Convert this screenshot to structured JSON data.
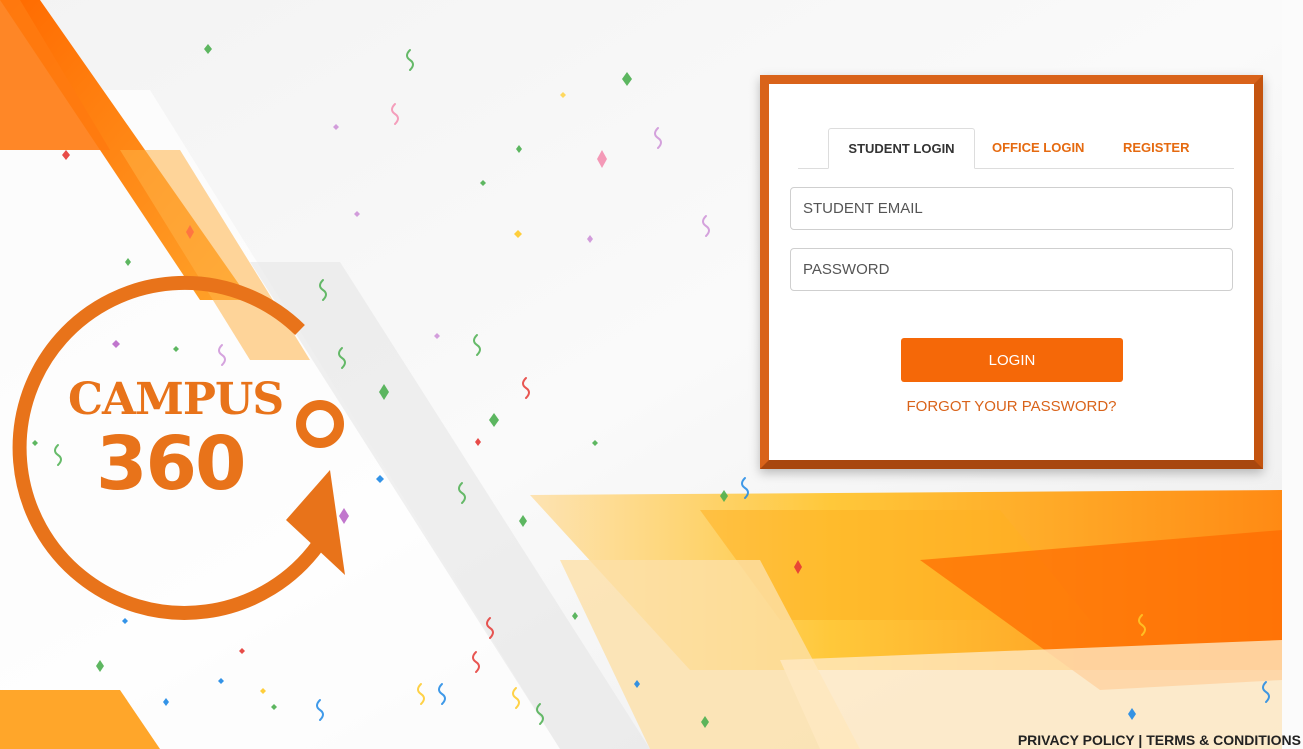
{
  "brand": {
    "word": "CAMPUS",
    "number": "360"
  },
  "tabs": [
    {
      "label": "STUDENT LOGIN",
      "active": true
    },
    {
      "label": "OFFICE LOGIN",
      "active": false
    },
    {
      "label": "REGISTER",
      "active": false
    }
  ],
  "form": {
    "email_placeholder": "STUDENT EMAIL",
    "password_placeholder": "PASSWORD",
    "login_label": "LOGIN",
    "forgot_label": "FORGOT YOUR PASSWORD?"
  },
  "footer": {
    "privacy_label": "PRIVACY POLICY",
    "separator": " | ",
    "terms_label": "TERMS & CONDITIONS"
  },
  "colors": {
    "accent": "#f56808",
    "brand_orange": "#e8731a",
    "card_border": "#d9631a"
  }
}
